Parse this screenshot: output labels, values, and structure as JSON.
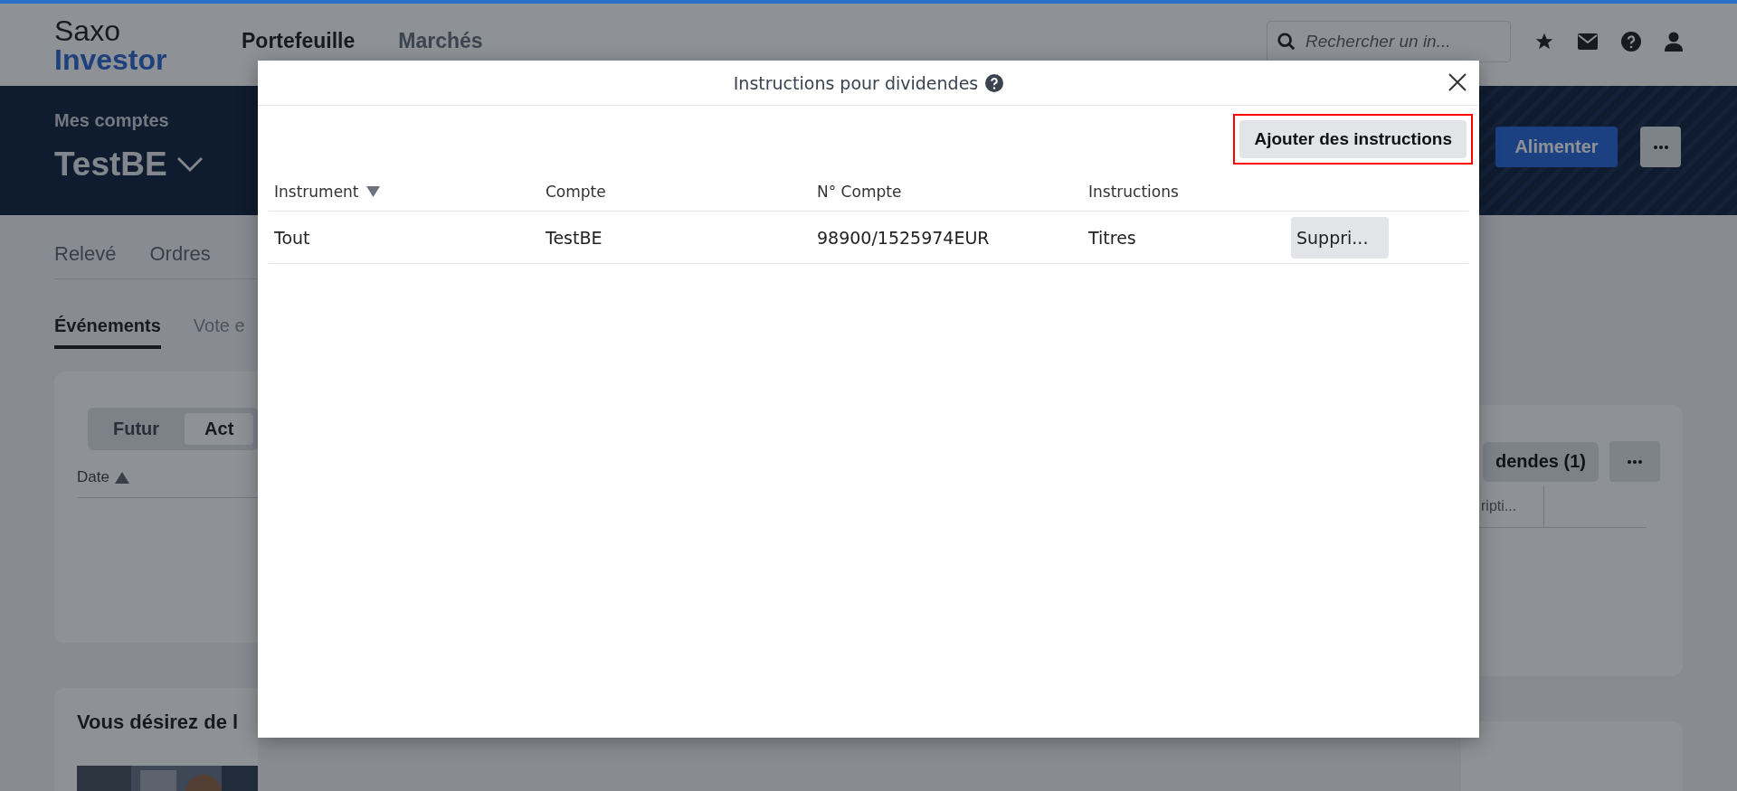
{
  "header": {
    "logo": {
      "line1": "Saxo",
      "line2": "Investor"
    },
    "nav": [
      {
        "label": "Portefeuille",
        "selected": true
      },
      {
        "label": "Marchés",
        "selected": false
      }
    ],
    "search": {
      "placeholder": "Rechercher un in..."
    }
  },
  "account_band": {
    "label": "Mes comptes",
    "account": "TestBE",
    "fund_button": "Alimenter"
  },
  "page_tabs": [
    {
      "label": "Relevé",
      "selected": false
    },
    {
      "label": "Ordres",
      "selected": false
    }
  ],
  "sub_tabs": [
    {
      "label": "Événements",
      "selected": true
    },
    {
      "label": "Vote e",
      "selected": false
    }
  ],
  "events_card": {
    "segments": [
      {
        "label": "Futur",
        "selected": false
      },
      {
        "label": "Act",
        "selected": true
      }
    ],
    "column_1": "Date",
    "right_button": "dendes (1)",
    "column_2": "ripti..."
  },
  "promo": {
    "title": "Vous désirez de l"
  },
  "dialog": {
    "title": "Instructions pour dividendes",
    "add_button": {
      "label": "Ajouter des instructions",
      "highlighted": true
    },
    "columns": [
      {
        "label": "Instrument",
        "sorted": true
      },
      {
        "label": "Compte",
        "sorted": false
      },
      {
        "label": "N° Compte",
        "sorted": false
      },
      {
        "label": "Instructions",
        "sorted": false
      }
    ],
    "rows": [
      {
        "instrument": "Tout",
        "account": "TestBE",
        "account_no": "98900/1525974EUR",
        "instructions": "Titres",
        "delete_button": "Suppri..."
      }
    ]
  }
}
